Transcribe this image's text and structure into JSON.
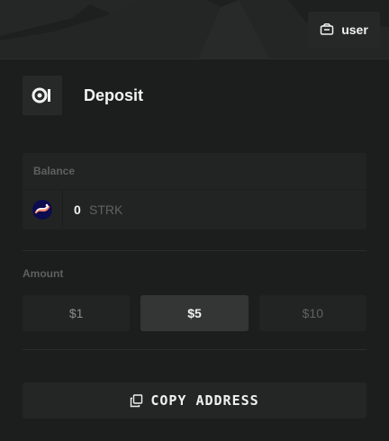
{
  "header": {
    "user_label": "user",
    "user_icon": "wallet-icon"
  },
  "deposit": {
    "title": "Deposit",
    "title_icon": "deposit-logo-icon"
  },
  "balance": {
    "label": "Balance",
    "amount": "0",
    "unit": "STRK",
    "token_icon": "strk-token-icon"
  },
  "amount": {
    "label": "Amount",
    "options": [
      "$1",
      "$5",
      "$10"
    ],
    "selected": "$5"
  },
  "copy": {
    "label": "COPY ADDRESS",
    "icon": "copy-icon"
  },
  "colors": {
    "background": "#1c1e1d",
    "card": "#222423",
    "selected": "#333634",
    "text": "#f2f2f2",
    "muted": "#5d605e"
  }
}
